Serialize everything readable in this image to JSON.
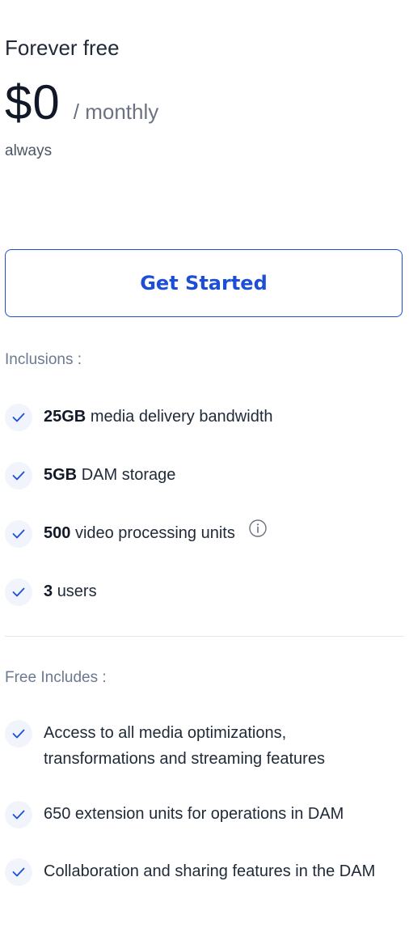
{
  "plan": {
    "name": "Forever free",
    "price": "$0",
    "period": "/ monthly",
    "note": "always"
  },
  "cta": {
    "label": "Get Started"
  },
  "inclusions": {
    "title": "Inclusions :",
    "items": [
      {
        "bold": "25GB",
        "text": "media delivery bandwidth"
      },
      {
        "bold": "5GB",
        "text": "DAM storage"
      },
      {
        "bold": "500",
        "text": "video processing units"
      },
      {
        "bold": "3",
        "text": "users"
      }
    ]
  },
  "free_includes": {
    "title": "Free Includes :",
    "items": [
      {
        "text": "Access to all media optimizations, transformations and streaming features"
      },
      {
        "text": "650 extension units for operations in DAM"
      },
      {
        "text": "Collaboration and sharing features in the DAM"
      }
    ]
  },
  "icons": {
    "check": "check-icon",
    "info": "info-icon"
  },
  "colors": {
    "accent": "#1d4ed8",
    "muted": "#6b7a90",
    "check_bg": "#f1f5fb"
  }
}
